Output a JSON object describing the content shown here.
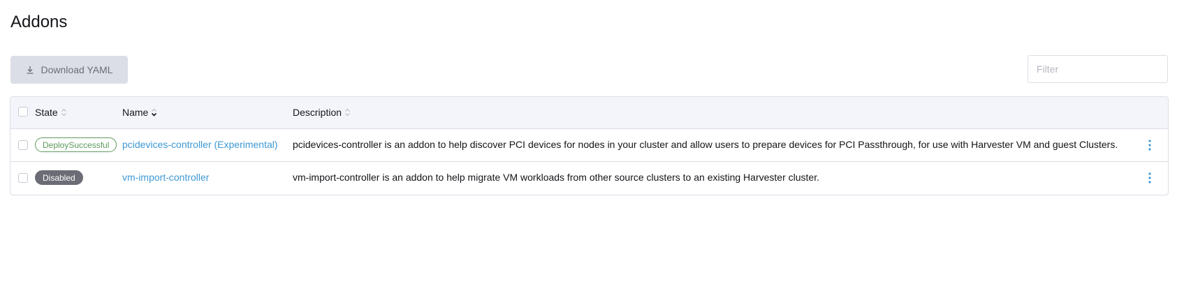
{
  "page": {
    "title": "Addons"
  },
  "toolbar": {
    "download_label": "Download YAML",
    "download_icon": "download-icon",
    "filter_placeholder": "Filter",
    "filter_value": ""
  },
  "table": {
    "columns": [
      {
        "label": "State",
        "sort": "unsorted"
      },
      {
        "label": "Name",
        "sort": "sorted"
      },
      {
        "label": "Description",
        "sort": "unsorted"
      }
    ],
    "rows": [
      {
        "state": "DeploySuccessful",
        "state_style": "success",
        "name": "pcidevices-controller (Experimental)",
        "description": "pcidevices-controller is an addon to help discover PCI devices for nodes in your cluster and allow users to prepare devices for PCI Passthrough, for use with Harvester VM and guest Clusters."
      },
      {
        "state": "Disabled",
        "state_style": "disabled",
        "name": "vm-import-controller",
        "description": "vm-import-controller is an addon to help migrate VM workloads from other source clusters to an existing Harvester cluster."
      }
    ]
  },
  "colors": {
    "link": "#3d98d3",
    "success": "#5d995d",
    "disabled_badge": "#6c6c76",
    "header_bg": "#f4f5fa",
    "button_bg": "#dcdee7"
  }
}
